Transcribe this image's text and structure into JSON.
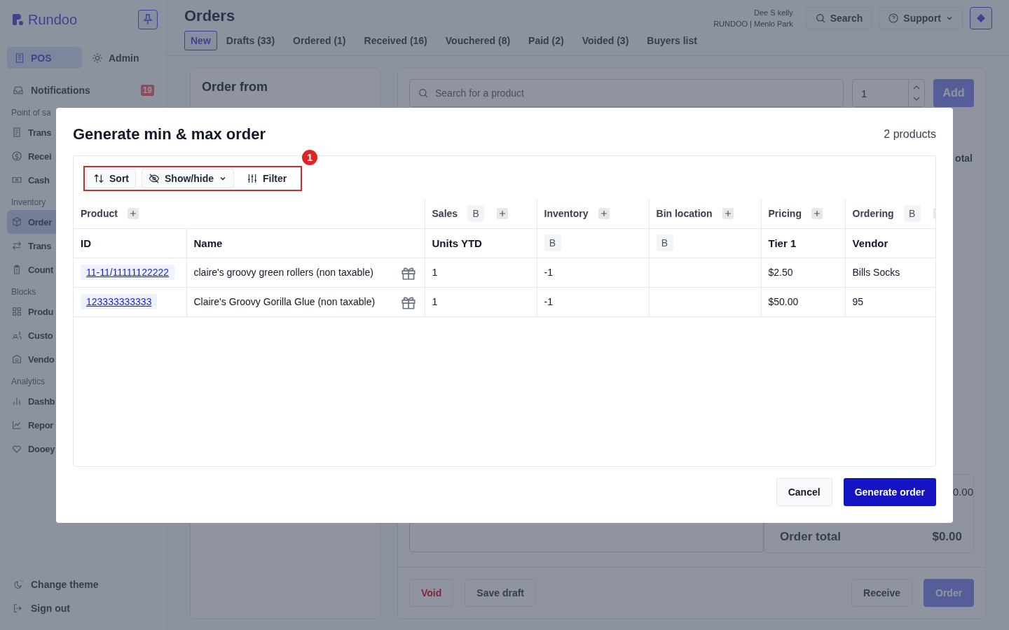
{
  "sidebar": {
    "brand": "Rundoo",
    "modes": [
      {
        "label": "POS",
        "selected": true
      },
      {
        "label": "Admin",
        "selected": false
      }
    ],
    "notifications": {
      "label": "Notifications",
      "count": "19"
    },
    "sections": [
      {
        "title": "Point of sa",
        "items": [
          {
            "label": "Trans",
            "selected": false
          },
          {
            "label": "Recei",
            "selected": false
          },
          {
            "label": "Cash",
            "selected": false
          }
        ]
      },
      {
        "title": "Inventory",
        "items": [
          {
            "label": "Order",
            "selected": true
          },
          {
            "label": "Trans",
            "selected": false
          },
          {
            "label": "Count",
            "selected": false
          }
        ]
      },
      {
        "title": "Blocks",
        "items": [
          {
            "label": "Produ",
            "selected": false
          },
          {
            "label": "Custo",
            "selected": false
          },
          {
            "label": "Vendo",
            "selected": false
          }
        ]
      },
      {
        "title": "Analytics",
        "items": [
          {
            "label": "Dashb",
            "selected": false
          },
          {
            "label": "Repor",
            "selected": false
          },
          {
            "label": "Dooey",
            "selected": false
          }
        ]
      }
    ],
    "footer": [
      "Change theme",
      "Sign out"
    ]
  },
  "header": {
    "title": "Orders",
    "tabs": [
      {
        "label": "New",
        "selected": true
      },
      {
        "label": "Drafts (33)",
        "selected": false
      },
      {
        "label": "Ordered (1)",
        "selected": false
      },
      {
        "label": "Received (16)",
        "selected": false
      },
      {
        "label": "Vouchered (8)",
        "selected": false
      },
      {
        "label": "Paid (2)",
        "selected": false
      },
      {
        "label": "Voided (3)",
        "selected": false
      },
      {
        "label": "Buyers list",
        "selected": false
      }
    ],
    "user": {
      "name": "Dee S kelly",
      "store": "RUNDOO | Menlo Park"
    },
    "search": "Search",
    "support": "Support"
  },
  "order_from": {
    "title": "Order from"
  },
  "product_search": {
    "placeholder": "Search for a product",
    "quantity": "1",
    "add": "Add"
  },
  "summary": {
    "column_label": "otal",
    "subtotal": "0.00",
    "total_label": "Order total",
    "total": "$0.00"
  },
  "actions": [
    {
      "label": "Void",
      "kind": "danger"
    },
    {
      "label": "Save draft",
      "kind": "secondary"
    },
    {
      "label": "Receive",
      "kind": "secondary"
    },
    {
      "label": "Order",
      "kind": "primary"
    }
  ],
  "modal": {
    "title": "Generate min & max order",
    "count": "2 products",
    "toolbar": [
      {
        "kind": "sort",
        "label": "Sort"
      },
      {
        "kind": "showhide",
        "label": "Show/hide"
      },
      {
        "kind": "filter",
        "label": "Filter"
      }
    ],
    "annotation": "1",
    "groups": [
      {
        "label": "Product",
        "columns": [
          {
            "label": "ID"
          },
          {
            "label": "Name"
          }
        ]
      },
      {
        "label": "Sales",
        "badge": "B",
        "columns": [
          {
            "label": "Units YTD"
          }
        ]
      },
      {
        "label": "Inventory",
        "columns": [
          {
            "badge": "B"
          }
        ]
      },
      {
        "label": "Bin location",
        "columns": [
          {
            "badge": "B"
          }
        ]
      },
      {
        "label": "Pricing",
        "columns": [
          {
            "label": "Tier 1"
          }
        ]
      },
      {
        "label": "Ordering",
        "badge": "B",
        "columns": [
          {
            "label": "Vendor"
          }
        ]
      }
    ],
    "rows": [
      {
        "id": "11-11/11111122222",
        "name": "claire's groovy green rollers (non taxable)",
        "units_ytd": "1",
        "inventory": "-1",
        "pricing": "$2.50",
        "vendor": "Bills Socks"
      },
      {
        "id": "123333333333",
        "name": "Claire's Groovy Gorilla Glue (non taxable)",
        "units_ytd": "1",
        "inventory": "-1",
        "pricing": "$50.00",
        "vendor": "95"
      }
    ],
    "buttons": [
      {
        "label": "Cancel",
        "kind": "secondary"
      },
      {
        "label": "Generate order",
        "kind": "primary"
      }
    ]
  }
}
